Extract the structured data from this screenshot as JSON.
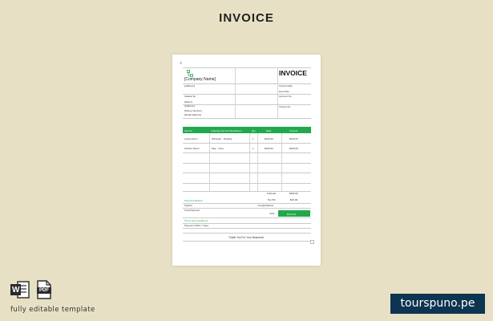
{
  "header": {
    "title": "INVOICE"
  },
  "invoice": {
    "company_name": "[Company Name]",
    "address": "[Address]",
    "doc_title": "INVOICE",
    "invoice_date_label": "Invoice Date",
    "due_date_label": "Due Date",
    "account_no_label": "Account No",
    "invoice_no_label": "Invoice No.",
    "invoice_to": "Invoice To:",
    "client_name": "[Name]",
    "client_address": "[Address]",
    "client_phone": "[Phone Number]",
    "client_email": "[Email Address]",
    "columns": [
      "Service",
      "Cleaning Service Breakdown",
      "Qty",
      "Rate",
      "Amount"
    ],
    "rows": [
      {
        "service": "Living Room",
        "breakdown": "Windows · Dusting",
        "qty": "1",
        "rate": "$100.00",
        "amount": "$100.00"
      },
      {
        "service": "Kitchen Room",
        "breakdown": "Mop · Dust",
        "qty": "1",
        "rate": "$100.00",
        "amount": "$100.00"
      }
    ],
    "subtotal_label": "Subtotal",
    "subtotal_value": "$300.00",
    "tax_label": "Tax 5%",
    "tax_value": "$15.00",
    "payment_method_label": "Payment Method",
    "paypal_label": "PayPal",
    "paypal_value": "Your@Address",
    "card_payment_label": "Card Payment",
    "total_label": "Total",
    "total_value": "$317.00",
    "terms_label": "Terms and Conditions",
    "terms_text": "Payment within 7 days",
    "thanks": "Thank You For Your Business!"
  },
  "footer": {
    "label": "fully editable template",
    "formats": [
      "W",
      "PDF"
    ],
    "brand": "tourspuno.pe"
  },
  "colors": {
    "background": "#e7e0c4",
    "accent": "#21a84d",
    "brand": "#0d3450"
  }
}
